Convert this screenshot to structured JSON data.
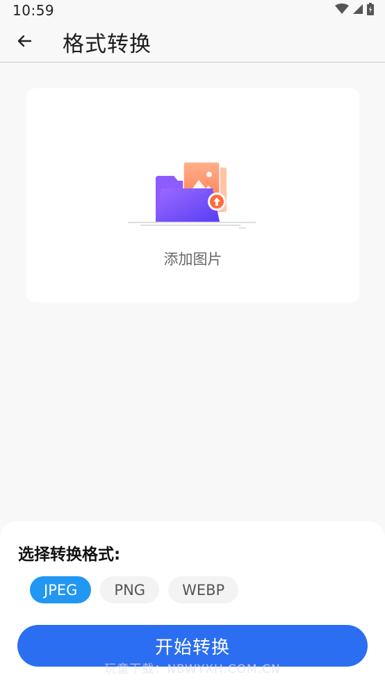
{
  "status_bar": {
    "time": "10:59",
    "icons": [
      "wifi-icon",
      "cellular-signal-icon",
      "battery-icon"
    ]
  },
  "app_bar": {
    "back_icon": "arrow-left-icon",
    "title": "格式转换"
  },
  "upload_card": {
    "illustration": "folder-upload-image-illustration",
    "label": "添加图片"
  },
  "format_sheet": {
    "title": "选择转换格式:",
    "formats": [
      {
        "label": "JPEG",
        "selected": true
      },
      {
        "label": "PNG",
        "selected": false
      },
      {
        "label": "WEBP",
        "selected": false
      }
    ],
    "start_button": "开始转换",
    "watermark": "玩童下载：NBWYXH.COM.CN"
  },
  "colors": {
    "accent": "#2c6ef2",
    "chip_selected": "#2196f3",
    "folder_purple": "#7c4dff",
    "photo_orange": "#ff8a5c"
  }
}
